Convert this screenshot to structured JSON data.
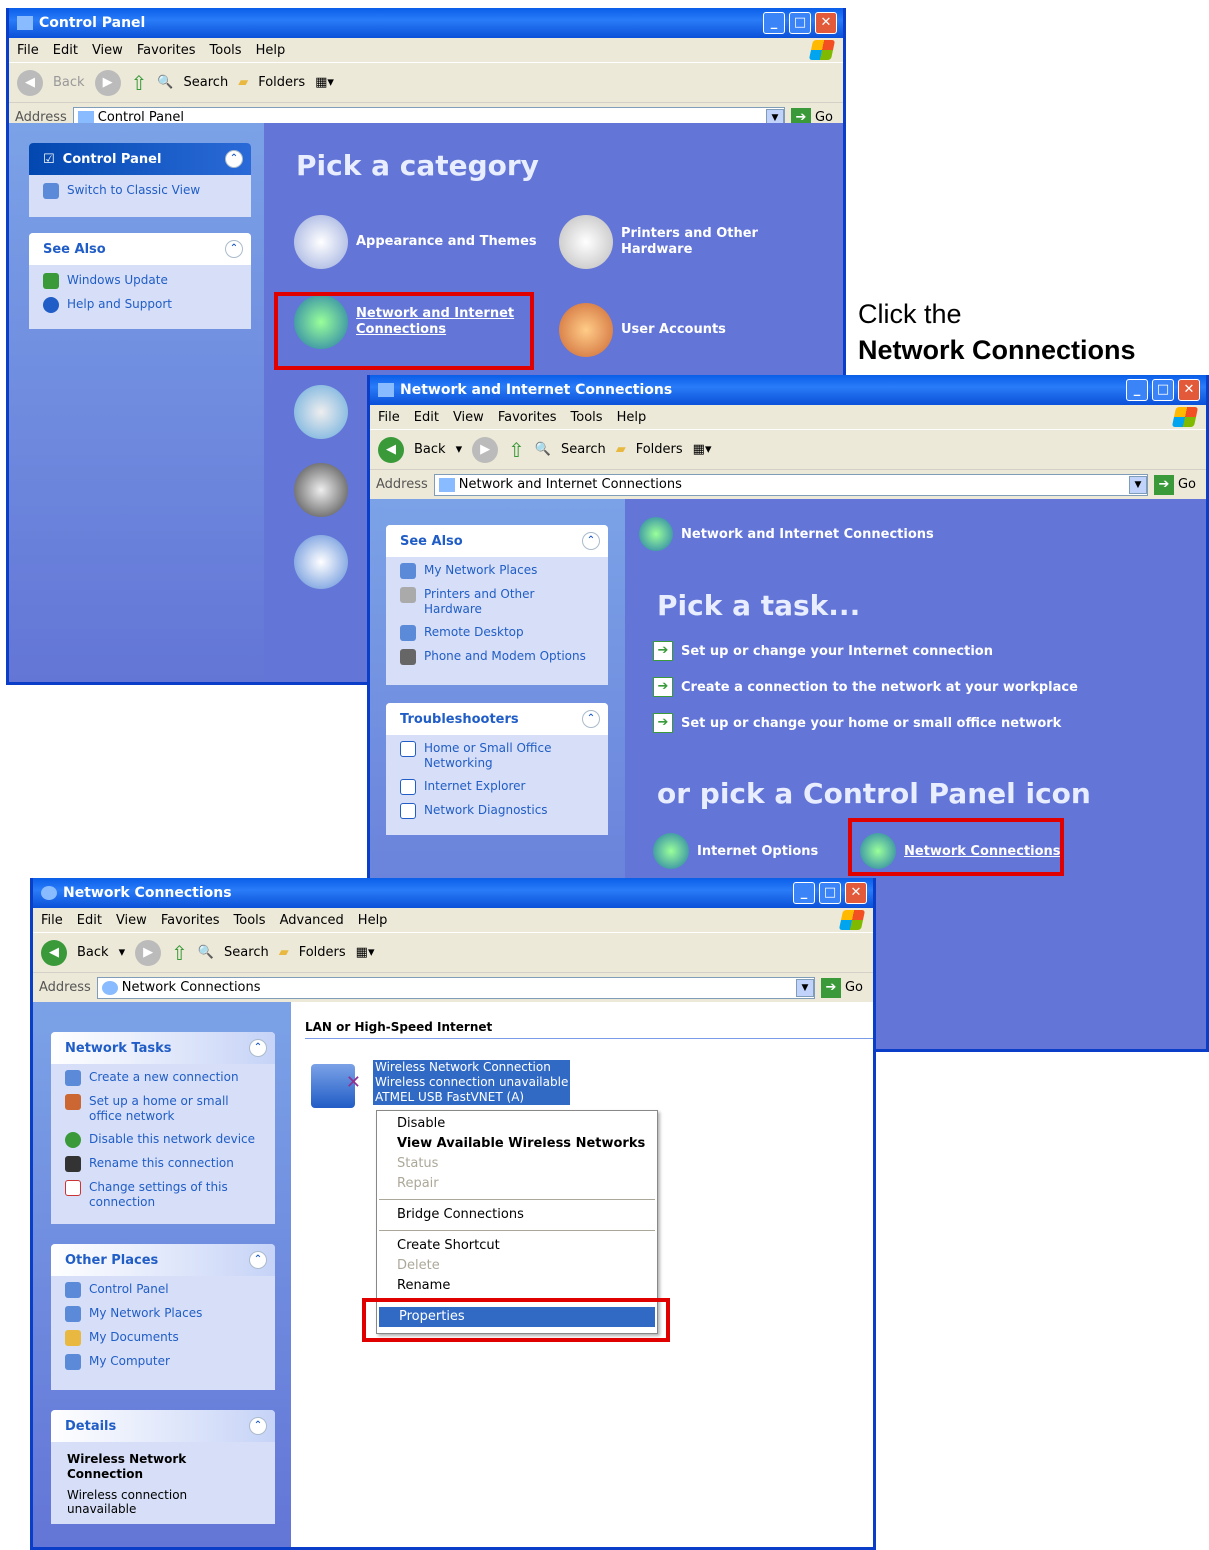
{
  "win1": {
    "title": "Control Panel",
    "menu": [
      "File",
      "Edit",
      "View",
      "Favorites",
      "Tools",
      "Help"
    ],
    "back": "Back",
    "search": "Search",
    "folders": "Folders",
    "address_label": "Address",
    "address": "Control Panel",
    "go": "Go",
    "side": {
      "cp_title": "Control Panel",
      "switch": "Switch to Classic View",
      "see_also": "See Also",
      "items": [
        "Windows Update",
        "Help and Support"
      ]
    },
    "main": {
      "heading": "Pick a category",
      "cats": [
        "Appearance and Themes",
        "Printers and Other Hardware",
        "Network and Internet Connections",
        "User Accounts"
      ]
    }
  },
  "annotation": {
    "line1": "Click the",
    "line2": "Network Connections"
  },
  "win2": {
    "title": "Network and Internet Connections",
    "menu": [
      "File",
      "Edit",
      "View",
      "Favorites",
      "Tools",
      "Help"
    ],
    "back": "Back",
    "search": "Search",
    "folders": "Folders",
    "address_label": "Address",
    "address": "Network and Internet Connections",
    "go": "Go",
    "side": {
      "see_also": "See Also",
      "see_items": [
        "My Network Places",
        "Printers and Other Hardware",
        "Remote Desktop",
        "Phone and Modem Options"
      ],
      "trouble": "Troubleshooters",
      "trouble_items": [
        "Home or Small Office Networking",
        "Internet Explorer",
        "Network Diagnostics"
      ]
    },
    "main": {
      "header": "Network and Internet Connections",
      "pick_task": "Pick a task...",
      "tasks": [
        "Set up or change your Internet connection",
        "Create a connection to the network at your workplace",
        "Set up or change your home or small office network"
      ],
      "or_pick": "or pick a Control Panel icon",
      "icons": [
        "Internet Options",
        "Network Connections"
      ]
    }
  },
  "win3": {
    "title": "Network Connections",
    "menu": [
      "File",
      "Edit",
      "View",
      "Favorites",
      "Tools",
      "Advanced",
      "Help"
    ],
    "back": "Back",
    "search": "Search",
    "folders": "Folders",
    "address_label": "Address",
    "address": "Network Connections",
    "go": "Go",
    "side": {
      "tasks_title": "Network Tasks",
      "tasks": [
        "Create a new connection",
        "Set up a home or small office network",
        "Disable this network device",
        "Rename this connection",
        "Change settings of this connection"
      ],
      "other_title": "Other Places",
      "other": [
        "Control Panel",
        "My Network Places",
        "My Documents",
        "My Computer"
      ],
      "details_title": "Details",
      "details_name": "Wireless Network Connection",
      "details_status": "Wireless connection unavailable"
    },
    "main": {
      "group": "LAN or High-Speed Internet",
      "conn": [
        "Wireless Network Connection",
        "Wireless connection unavailable",
        "ATMEL USB FastVNET (A)"
      ]
    },
    "context": [
      "Disable",
      "View Available Wireless Networks",
      "Status",
      "Repair",
      "Bridge Connections",
      "Create Shortcut",
      "Delete",
      "Rename",
      "Properties"
    ]
  }
}
